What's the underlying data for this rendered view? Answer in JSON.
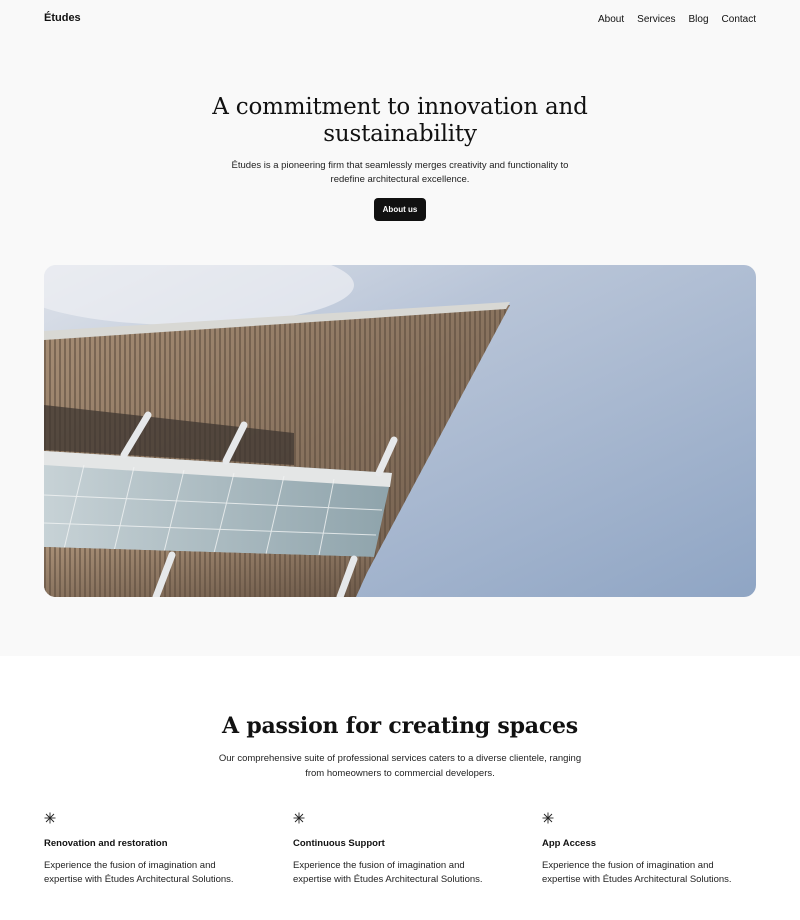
{
  "header": {
    "brand": "Études",
    "nav": [
      "About",
      "Services",
      "Blog",
      "Contact"
    ]
  },
  "hero": {
    "title": "A commitment to innovation and sustainability",
    "subtitle": "Études is a pioneering firm that seamlessly merges creativity and functionality to redefine architectural excellence.",
    "button_label": "About us",
    "image_subject": "modern building canopy against blue sky"
  },
  "services": {
    "title": "A passion for creating spaces",
    "subtitle": "Our comprehensive suite of professional services caters to a diverse clientele, ranging from homeowners to commercial developers.",
    "features": [
      {
        "icon": "asterisk-icon",
        "title": "Renovation and restoration",
        "body": "Experience the fusion of imagination and expertise with Études Architectural Solutions."
      },
      {
        "icon": "asterisk-icon",
        "title": "Continuous Support",
        "body": "Experience the fusion of imagination and expertise with Études Architectural Solutions."
      },
      {
        "icon": "asterisk-icon",
        "title": "App Access",
        "body": "Experience the fusion of imagination and expertise with Études Architectural Solutions."
      }
    ]
  },
  "colors": {
    "background": "#f9f9f9",
    "section_background": "#ffffff",
    "text": "#111111",
    "button": "#111111",
    "sky": "#9fb3cf"
  }
}
